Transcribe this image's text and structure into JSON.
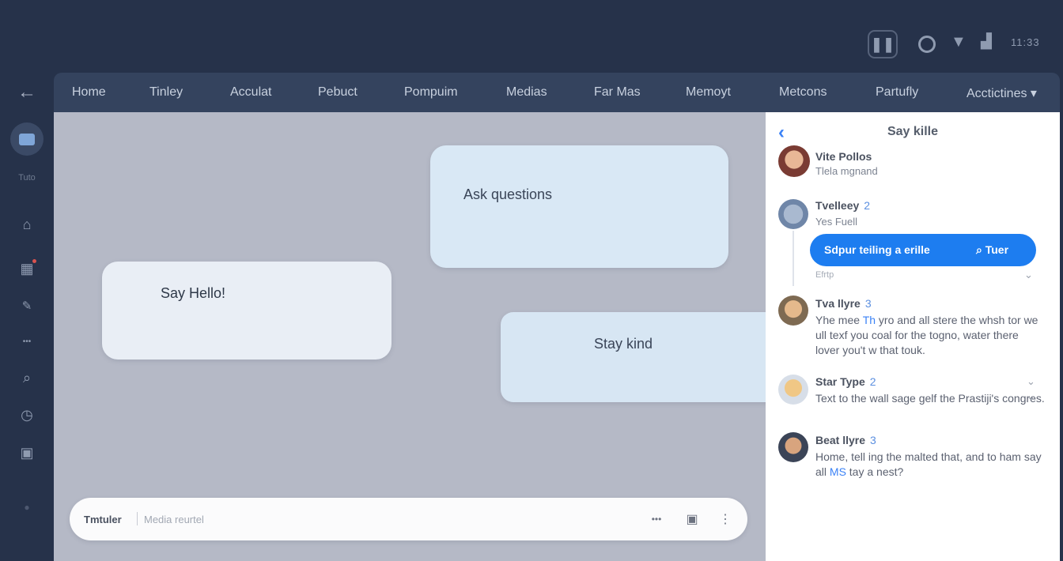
{
  "status_bar": {
    "time": "11:33"
  },
  "rail": {
    "label": "Tuto"
  },
  "nav": {
    "tabs": [
      "Home",
      "Tinley",
      "Acculat",
      "Pebuct",
      "Pompuim",
      "Medias",
      "Far Mas",
      "Memoyt",
      "Metcons",
      "Partufly",
      "Acctictines ▾"
    ]
  },
  "canvas": {
    "bubbles": {
      "ask": "Ask questions",
      "hello": "Say Hello!",
      "kind": "Stay kind"
    },
    "composer": {
      "label": "Tmtuler",
      "placeholder": "Media reurtel"
    }
  },
  "panel": {
    "title": "Say kille",
    "profile": {
      "name": "Vite Pollos",
      "subtitle": "Tlela mgnand"
    },
    "threads": [
      {
        "name": "Tvelleey",
        "count": "2",
        "text": "Yes Fuell",
        "pill_text": "Sdpur teiling a erille",
        "pill_action": "Tuer",
        "meta": "Efrtp"
      },
      {
        "name": "Tva llyre",
        "count": "3",
        "text_before": "Yhe mee",
        "text_highlight": "Th",
        "text_after": " yro and all stere the whsh tor we ull texf you coal for the togno, water there lover you't w that touk."
      },
      {
        "name": "Star Type",
        "count": "2",
        "text": "Text to the wall sage gelf the Prastiji's congres."
      },
      {
        "name": "Beat llyre",
        "count": "3",
        "text_before": "Home, tell ing the malted that, and to ham say all ",
        "text_highlight": "MS",
        "text_after": " tay a nest?"
      }
    ]
  },
  "colors": {
    "app_bg": "#26324a",
    "nav_bg": "#34435e",
    "canvas_bg": "#b5b9c6",
    "accent": "#1d7df0"
  }
}
